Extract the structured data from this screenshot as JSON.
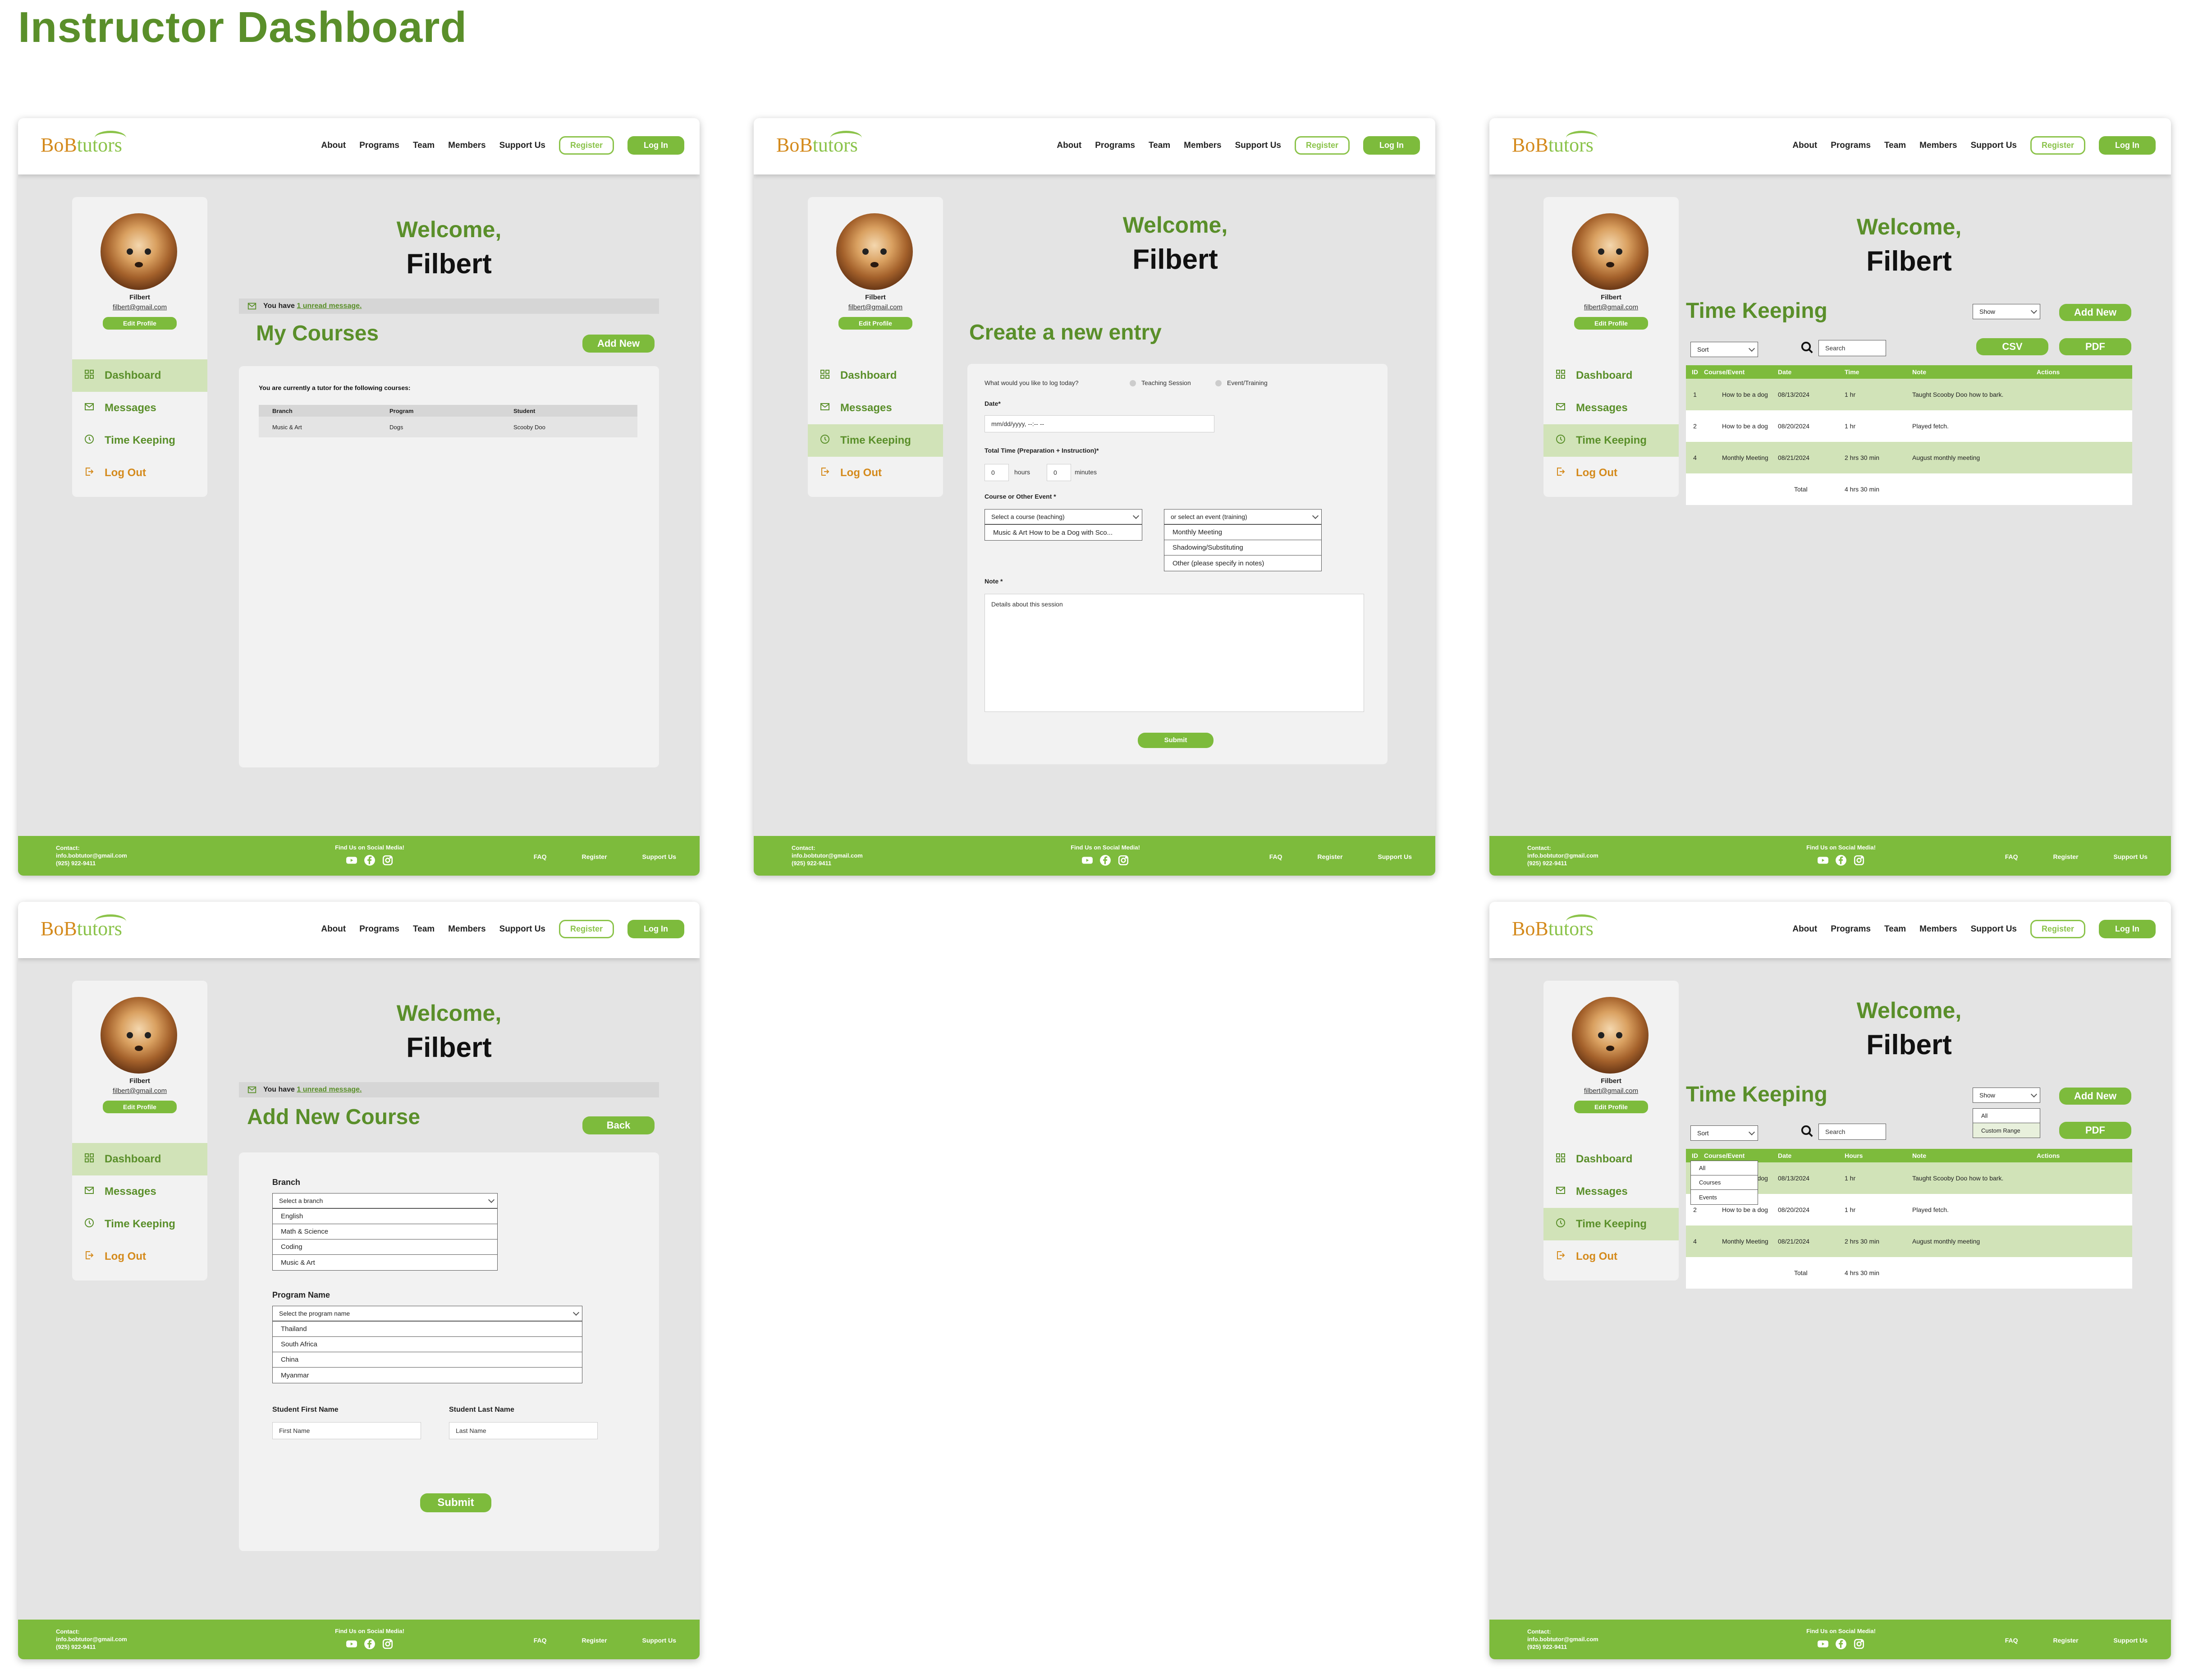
{
  "page": {
    "title": "Instructor Dashboard"
  },
  "colors": {
    "primary_green": "#7dbb3c",
    "dark_green": "#5a8f2a",
    "light_green": "#d1e3b8",
    "orange": "#d48a1c",
    "bg_gray": "#e4e4e4"
  },
  "nav": {
    "logo": {
      "part1": "BoB",
      "part2": "tutors"
    },
    "links": [
      "About",
      "Programs",
      "Team",
      "Members",
      "Support Us"
    ],
    "register": "Register",
    "login": "Log In"
  },
  "profile": {
    "name": "Filbert",
    "email": "filbert@gmail.com",
    "edit": "Edit Profile"
  },
  "sidebar": {
    "items": [
      "Dashboard",
      "Messages",
      "Time Keeping",
      "Log Out"
    ],
    "icons": [
      "grid-icon",
      "mail-icon",
      "clock-icon",
      "logout-icon"
    ]
  },
  "welcome": {
    "line1": "Welcome,",
    "line2": "Filbert"
  },
  "unread": {
    "prefix": "You have ",
    "link": "1 unread message."
  },
  "footer": {
    "contact_label": "Contact:",
    "email": "info.bobtutor@gmail.com",
    "phone": "(925) 922-9411",
    "social": "Find Us on Social Media!",
    "links": [
      "FAQ",
      "Register",
      "Support Us"
    ],
    "icons": [
      "youtube-icon",
      "facebook-icon",
      "instagram-icon"
    ]
  },
  "courses": {
    "title": "My Courses",
    "add_new": "Add New",
    "intro": "You are currently a tutor for the following courses:",
    "headers": [
      "Branch",
      "Program",
      "Student"
    ],
    "rows": [
      [
        "Music & Art",
        "Dogs",
        "Scooby Doo"
      ]
    ]
  },
  "entry": {
    "title": "Create a new entry",
    "question": "What would you like to log today?",
    "options": [
      "Teaching Session",
      "Event/Training"
    ],
    "date_label": "Date*",
    "date_placeholder": "mm/dd/yyyy, --:-- --",
    "time_label": "Total Time (Preparation + Instruction)*",
    "hours_value": "0",
    "hours_label": "hours",
    "minutes_value": "0",
    "minutes_label": "minutes",
    "course_label": "Course or Other Event *",
    "course_select": "Select a course (teaching)",
    "course_options": [
      "Music & Art How to be a Dog with Sco..."
    ],
    "event_select": "or select an event (training)",
    "event_options": [
      "Monthly Meeting",
      "Shadowing/Substituting",
      "Other (please specify in notes)"
    ],
    "note_label": "Note *",
    "note_placeholder": "Details about this session",
    "submit": "Submit"
  },
  "timekeeping": {
    "title": "Time Keeping",
    "show": "Show",
    "add_new": "Add New",
    "sort": "Sort",
    "search": "Search",
    "csv": "CSV",
    "pdf": "PDF",
    "headers": [
      "ID",
      "Course/Event",
      "Date",
      "Time",
      "Note",
      "Actions"
    ],
    "headers_alt": [
      "ID",
      "Course/Event",
      "Date",
      "Hours",
      "Note",
      "Actions"
    ],
    "rows": [
      {
        "id": "1",
        "course": "How to be a dog",
        "date": "08/13/2024",
        "time": "1 hr",
        "note": "Taught Scooby Doo how to bark."
      },
      {
        "id": "2",
        "course": "How to be a dog",
        "date": "08/20/2024",
        "time": "1 hr",
        "note": "Played fetch."
      },
      {
        "id": "4",
        "course": "Monthly Meeting",
        "date": "08/21/2024",
        "time": "2 hrs 30 min",
        "note": "August monthly meeting"
      }
    ],
    "total_label": "Total",
    "total_value": "4 hrs 30 min",
    "sort_options": [
      "All",
      "Courses",
      "Events"
    ],
    "show_options": [
      "All",
      "Custom Range"
    ]
  },
  "addcourse": {
    "title": "Add New Course",
    "back": "Back",
    "branch_label": "Branch",
    "branch_select": "Select a branch",
    "branch_options": [
      "English",
      "Math & Science",
      "Coding",
      "Music & Art"
    ],
    "program_label": "Program Name",
    "program_select": "Select the program name",
    "program_options": [
      "Thailand",
      "South Africa",
      "China",
      "Myanmar"
    ],
    "first_label": "Student First Name",
    "first_placeholder": "First Name",
    "last_label": "Student Last Name",
    "last_placeholder": "Last Name",
    "submit": "Submit"
  }
}
